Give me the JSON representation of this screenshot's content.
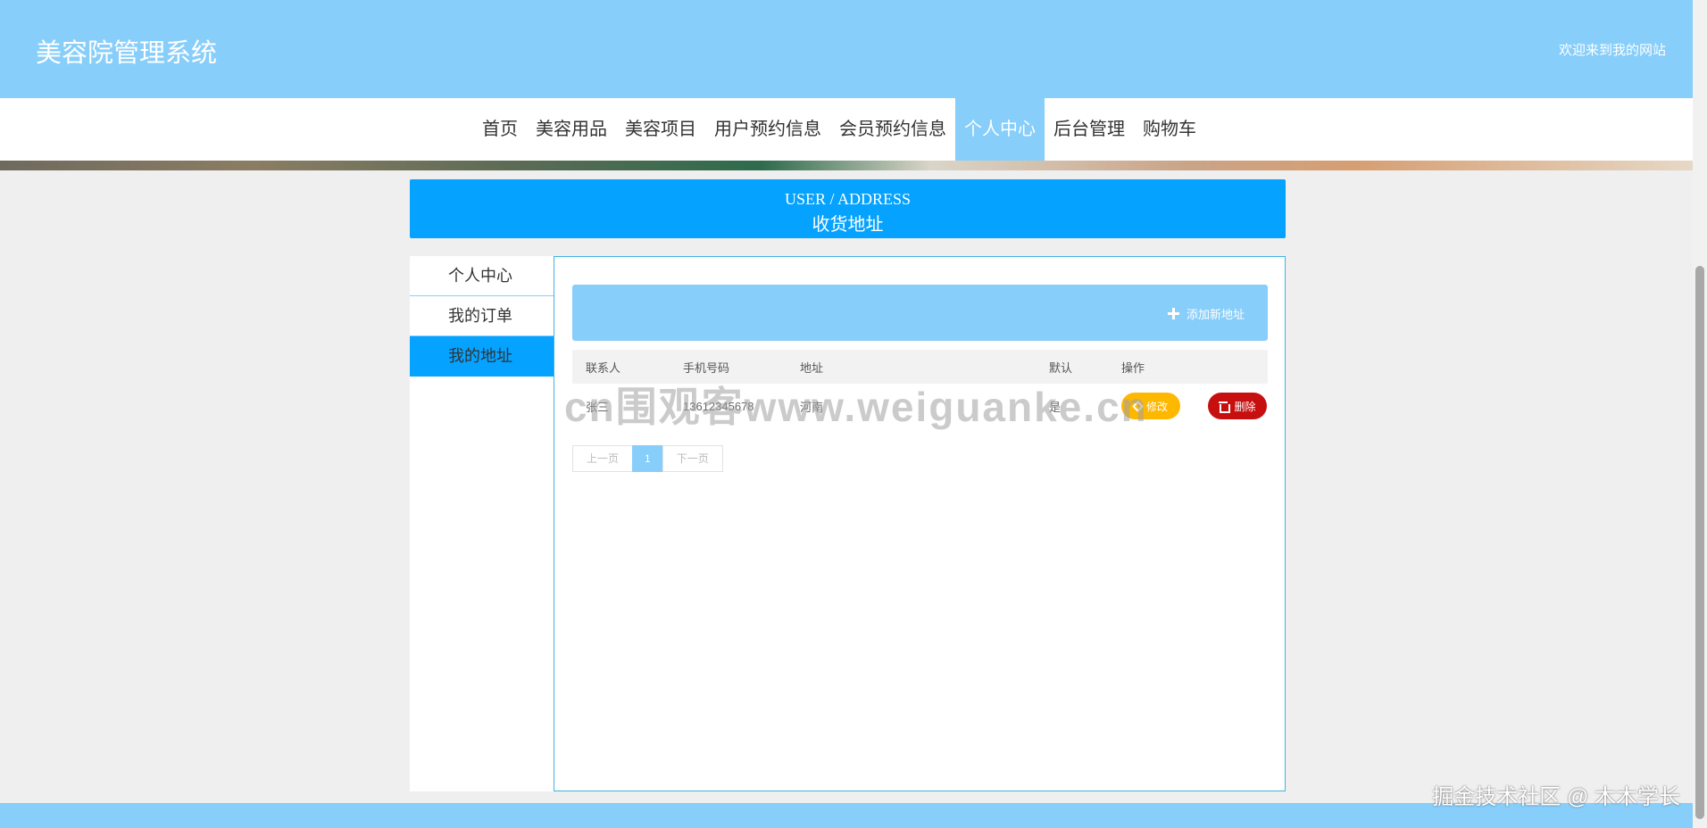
{
  "header": {
    "site_title": "美容院管理系统",
    "welcome": "欢迎来到我的网站"
  },
  "nav": {
    "items": [
      {
        "label": "首页"
      },
      {
        "label": "美容用品"
      },
      {
        "label": "美容项目"
      },
      {
        "label": "用户预约信息"
      },
      {
        "label": "会员预约信息"
      },
      {
        "label": "个人中心",
        "active": true
      },
      {
        "label": "后台管理"
      },
      {
        "label": "购物车"
      }
    ]
  },
  "page_banner": {
    "en": "USER / ADDRESS",
    "zh": "收货地址"
  },
  "side_menu": {
    "items": [
      {
        "label": "个人中心"
      },
      {
        "label": "我的订单"
      },
      {
        "label": "我的地址",
        "active": true
      }
    ]
  },
  "content": {
    "add_button_label": "添加新地址",
    "table": {
      "headers": [
        "联系人",
        "手机号码",
        "地址",
        "默认",
        "操作"
      ],
      "rows": [
        {
          "contact": "张三",
          "phone": "13612345678",
          "address": "河南",
          "default": "是"
        }
      ],
      "edit_label": "修改",
      "delete_label": "删除"
    },
    "pager": {
      "prev": "上一页",
      "current": "1",
      "next": "下一页"
    }
  },
  "watermarks": {
    "center": "cn围观客www.weiguanke.cn",
    "corner": "掘金技术社区 @ 木木学长"
  },
  "colors": {
    "header_bg": "#87cefa",
    "banner_bg": "#05a2ff",
    "edit_btn": "#ffb800",
    "delete_btn": "#c80f0f"
  }
}
